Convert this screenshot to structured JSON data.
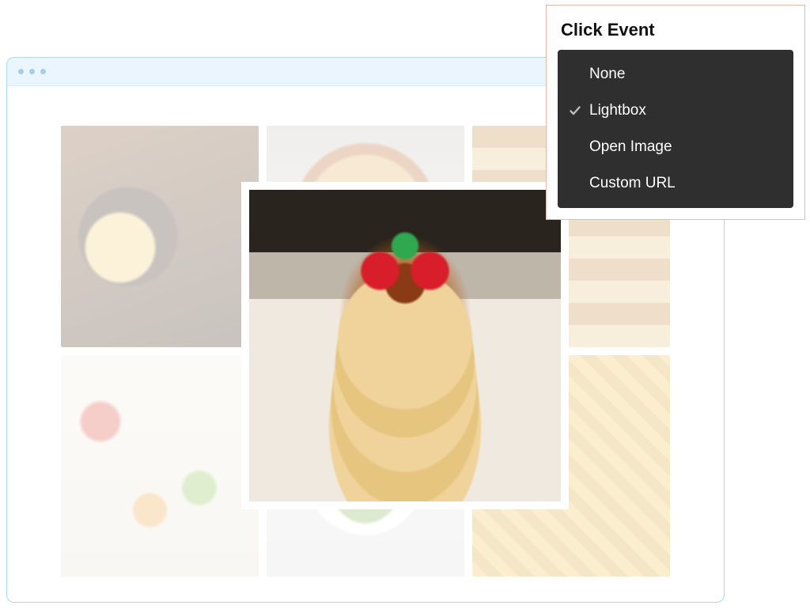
{
  "dropdown": {
    "title": "Click Event",
    "selected_index": 1,
    "items": [
      {
        "label": "None"
      },
      {
        "label": "Lightbox"
      },
      {
        "label": "Open Image"
      },
      {
        "label": "Custom URL"
      }
    ]
  },
  "gallery": {
    "thumbnails": [
      {
        "name": "rice-bowl-egg"
      },
      {
        "name": "pizza"
      },
      {
        "name": "pancakes-stack"
      },
      {
        "name": "canapes-assortment"
      },
      {
        "name": "salad-bowl"
      },
      {
        "name": "pasta"
      }
    ],
    "lightbox_image": {
      "name": "pancakes-caramel-berries"
    }
  },
  "colors": {
    "panel_border": "#f3b6ad",
    "dropdown_bg": "#2f2f2f",
    "window_border": "#a9d8f4",
    "chrome_bg": "#eaf5fd"
  }
}
